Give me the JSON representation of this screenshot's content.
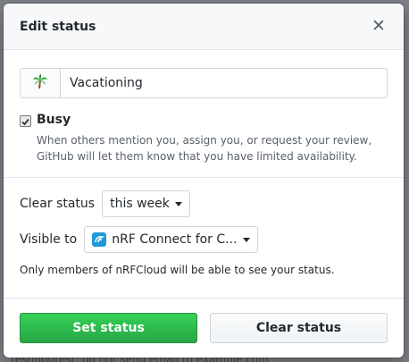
{
  "background": {
    "snippet": "testinputest: do not send email to example.com"
  },
  "dialog": {
    "title": "Edit status",
    "close_icon": "close-icon"
  },
  "status": {
    "emoji": "palm-tree-icon",
    "value": "Vacationing",
    "busy": {
      "checked": true,
      "label": "Busy",
      "description": "When others mention you, assign you, or request your review, GitHub will let them know that you have limited availability."
    }
  },
  "clear_status": {
    "label": "Clear status",
    "selected": "this week"
  },
  "visibility": {
    "label": "Visible to",
    "selected": "nRF Connect for C...",
    "org_icon": "nrf-cloud-icon",
    "note": "Only members of nRFCloud will be able to see your status."
  },
  "footer": {
    "set_label": "Set status",
    "clear_label": "Clear status"
  },
  "colors": {
    "primary_button": "#28a745",
    "org_icon": "#1f9ad6"
  }
}
